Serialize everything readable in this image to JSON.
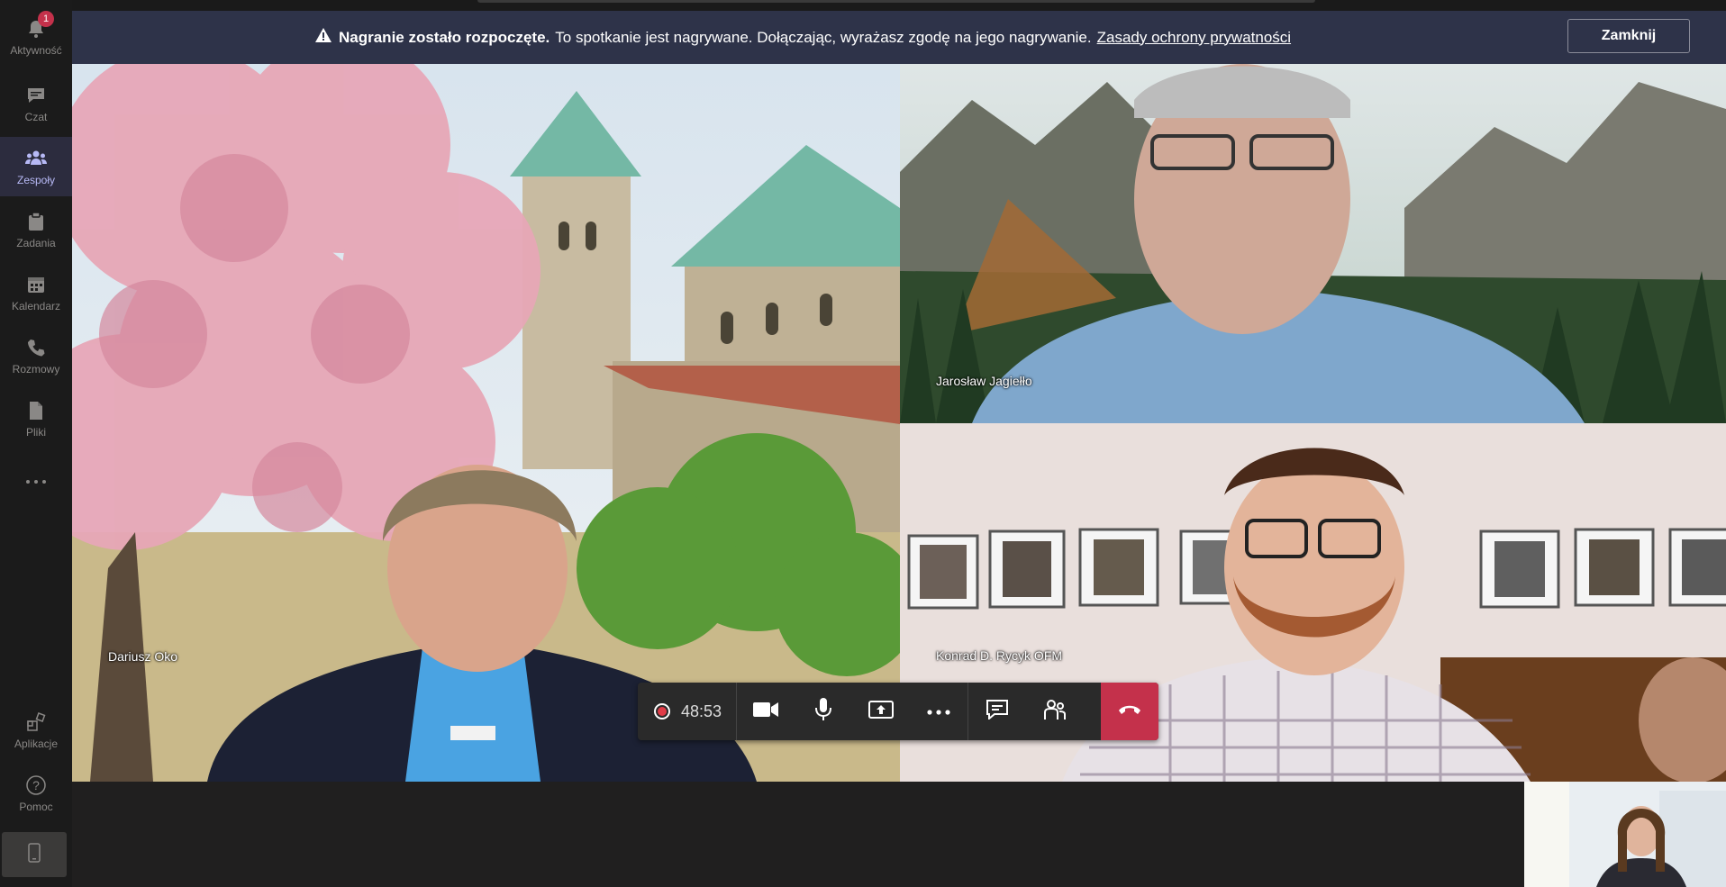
{
  "rail": {
    "items": [
      {
        "label": "Aktywność",
        "icon": "bell-icon",
        "badge": "1"
      },
      {
        "label": "Czat",
        "icon": "chat-icon"
      },
      {
        "label": "Zespoły",
        "icon": "teams-icon",
        "active": true
      },
      {
        "label": "Zadania",
        "icon": "tasks-icon"
      },
      {
        "label": "Kalendarz",
        "icon": "calendar-icon"
      },
      {
        "label": "Rozmowy",
        "icon": "phone-icon"
      },
      {
        "label": "Pliki",
        "icon": "file-icon"
      },
      {
        "label": "...",
        "icon": "more-icon"
      }
    ],
    "bottom": [
      {
        "label": "Aplikacje",
        "icon": "apps-icon"
      },
      {
        "label": "Pomoc",
        "icon": "help-icon"
      }
    ]
  },
  "banner": {
    "bold": "Nagranie zostało rozpoczęte.",
    "text": "To spotkanie jest nagrywane. Dołączając, wyrażasz zgodę na jego nagrywanie.",
    "link": "Zasady ochrony prywatności",
    "close": "Zamknij"
  },
  "participants": {
    "p1": "Dariusz Oko",
    "p2": "Jarosław Jagiełło",
    "p3": "Konrad D. Rycyk OFM"
  },
  "toolbar": {
    "timer": "48:53"
  },
  "colors": {
    "accent": "#6264a7",
    "hangup": "#c4314b",
    "banner": "#2e3349"
  }
}
